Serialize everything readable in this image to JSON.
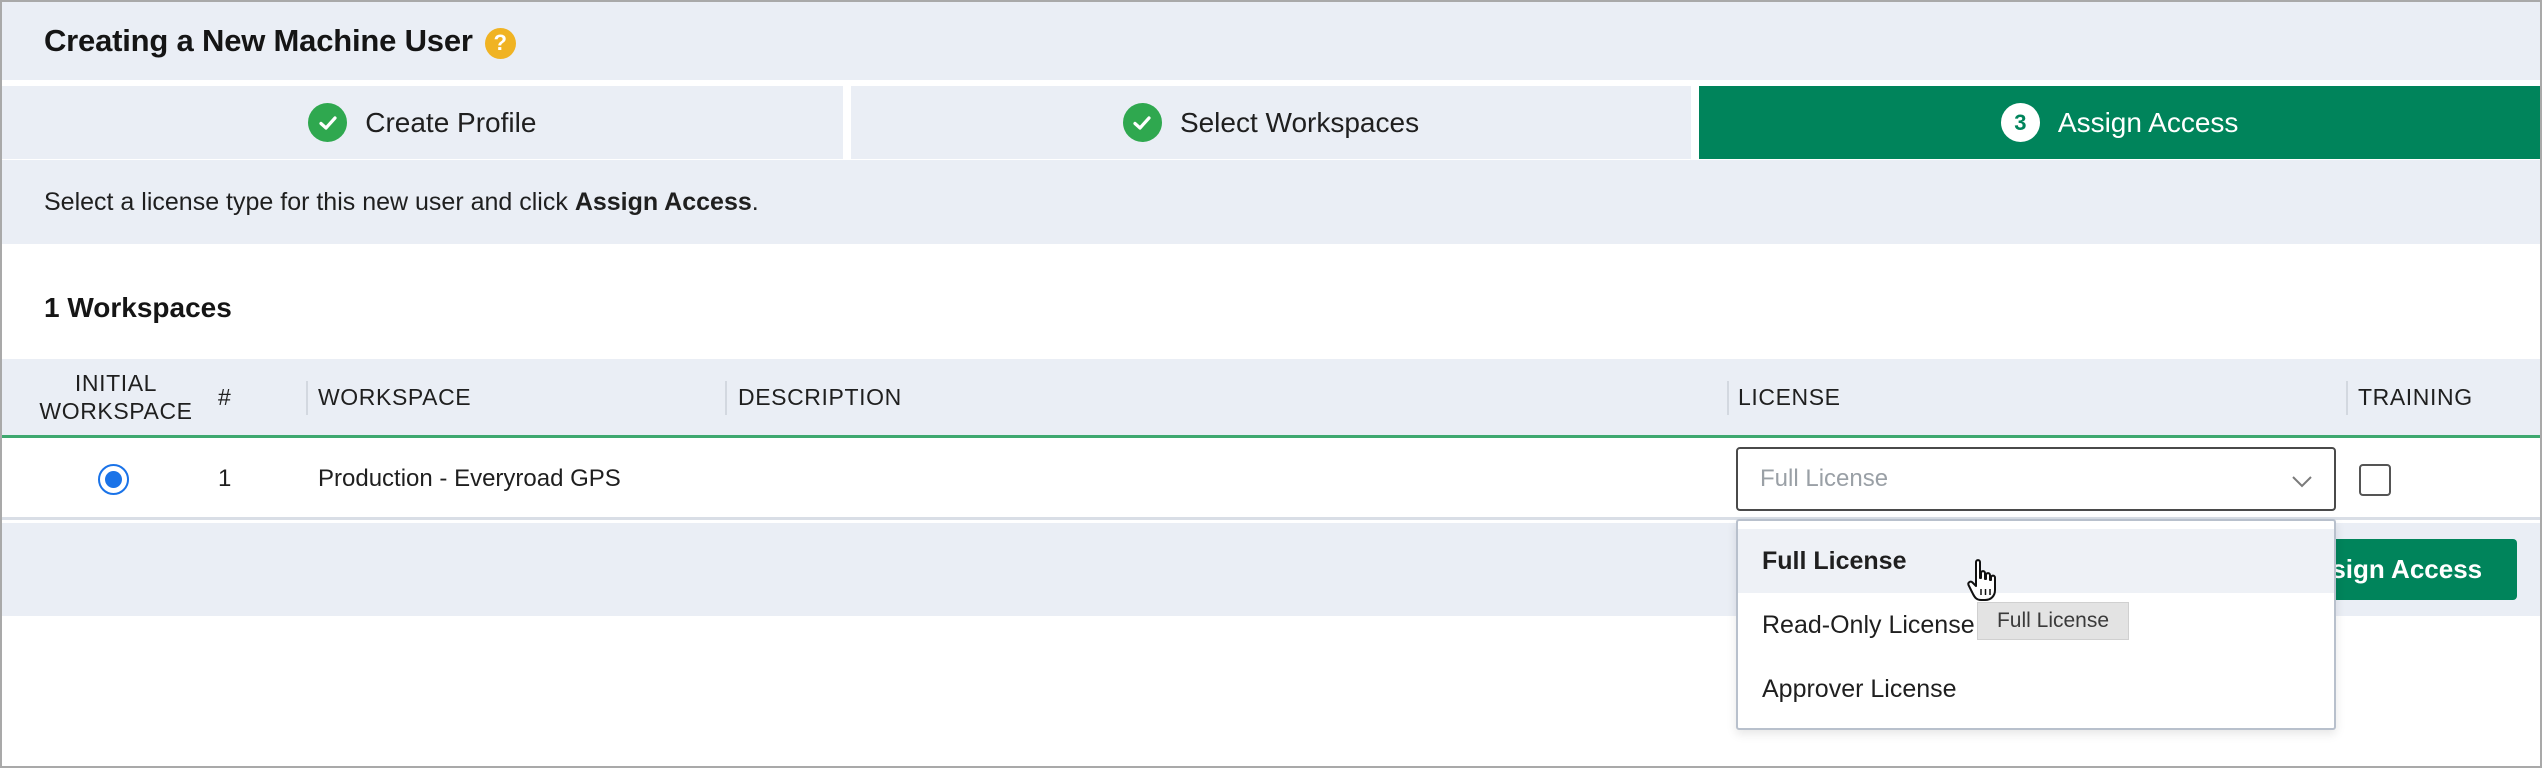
{
  "header": {
    "title": "Creating a New Machine User",
    "help_glyph": "?"
  },
  "steps": [
    {
      "label": "Create Profile",
      "state": "complete",
      "icon": "check-circle-icon"
    },
    {
      "label": "Select Workspaces",
      "state": "complete",
      "icon": "check-circle-icon"
    },
    {
      "label": "Assign Access",
      "state": "active",
      "number": "3"
    }
  ],
  "instruction": {
    "prefix": "Select a license type for this new user and click ",
    "emphasis": "Assign Access",
    "suffix": "."
  },
  "workspace_count_label": "1 Workspaces",
  "table": {
    "columns": {
      "initial_workspace": "INITIAL WORKSPACE",
      "number": "#",
      "workspace": "WORKSPACE",
      "description": "DESCRIPTION",
      "license": "LICENSE",
      "training": "TRAINING"
    },
    "rows": [
      {
        "initial_selected": true,
        "number": "1",
        "workspace": "Production - Everyroad GPS",
        "description": "",
        "license_placeholder": "Full License",
        "training_checked": false
      }
    ]
  },
  "license_menu": {
    "options": [
      "Full License",
      "Read-Only License",
      "Approver License"
    ],
    "hovered_option": "Full License",
    "tooltip": "Full License"
  },
  "footer": {
    "assign_button_label": "ssign Access"
  },
  "colors": {
    "accent_green": "#00845b",
    "check_green": "#2fa84f",
    "help_yellow": "#f0b323",
    "panel_bg": "#eaeef5",
    "radio_blue": "#1a73e8"
  }
}
